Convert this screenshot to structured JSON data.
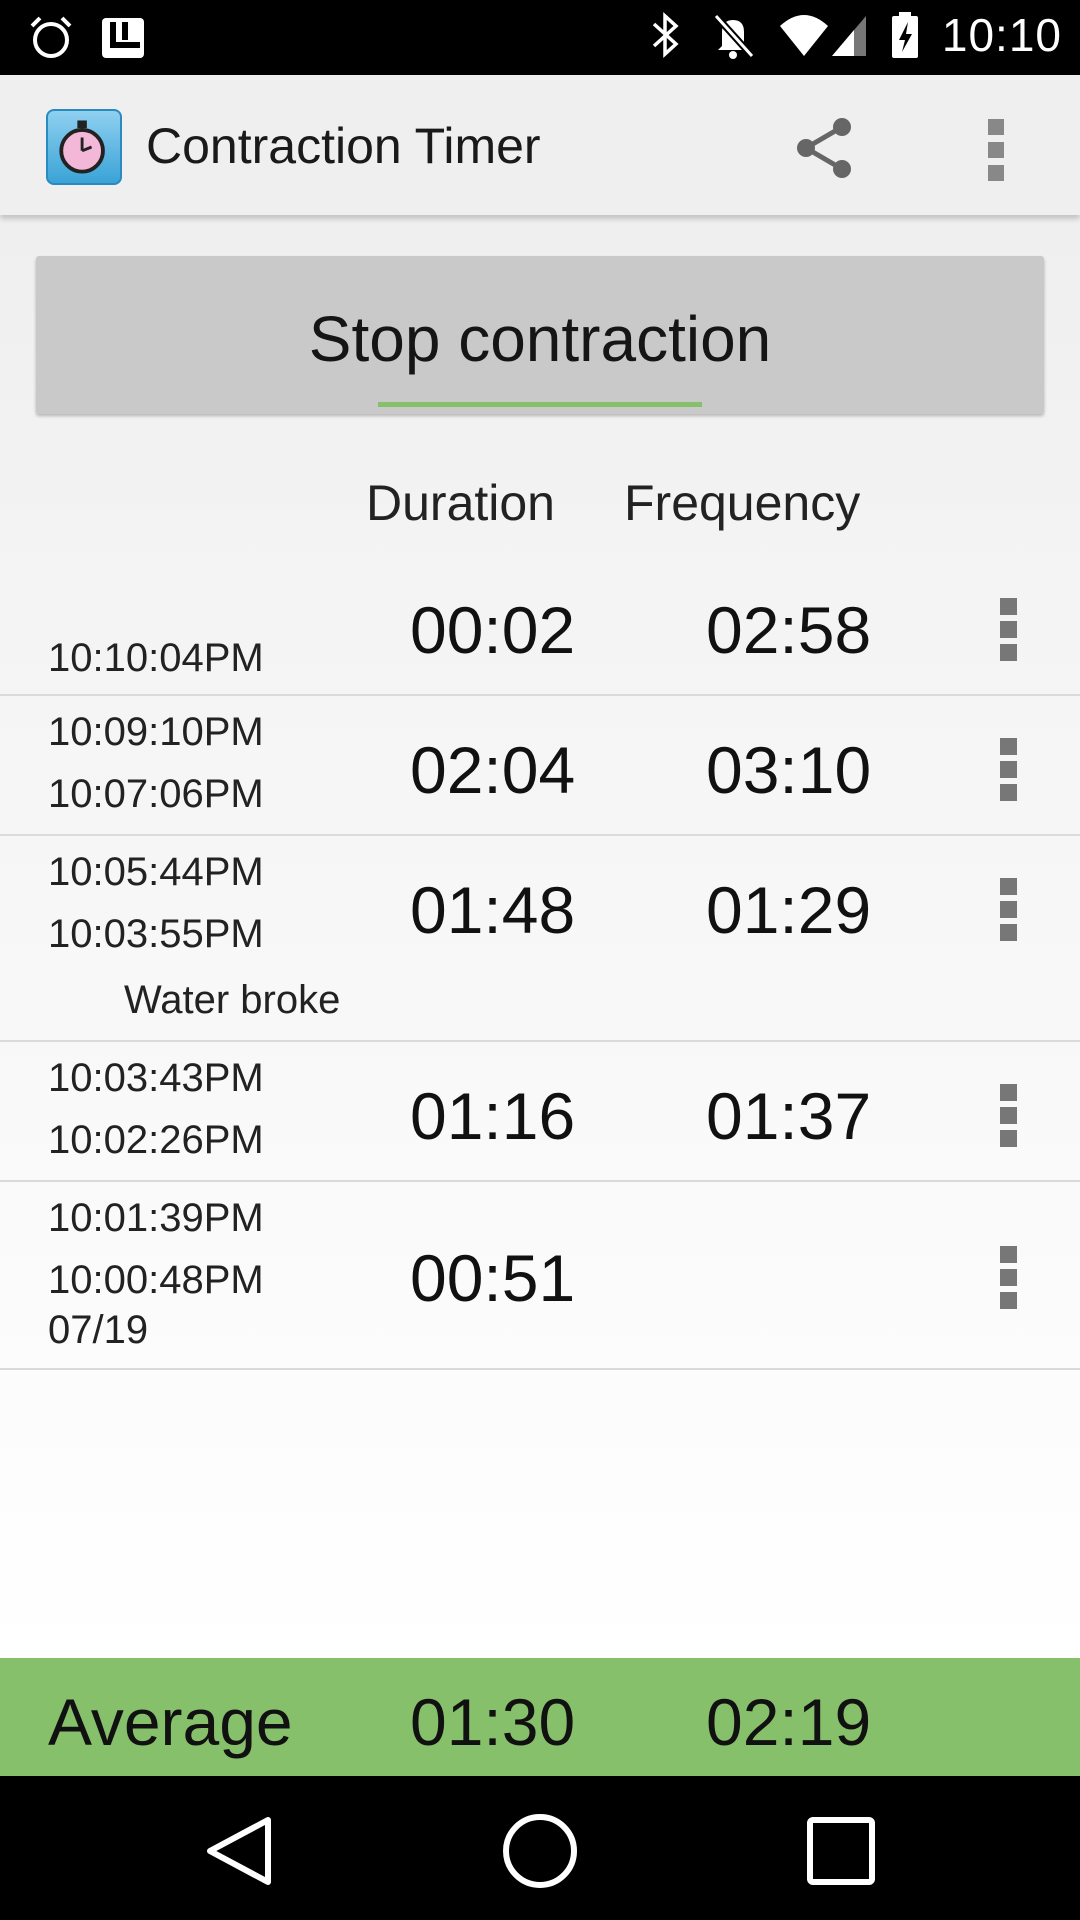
{
  "status_bar": {
    "time": "10:10",
    "icons": [
      "alarm-icon",
      "launcher-icon",
      "bluetooth-icon",
      "muted-bell-icon",
      "wifi-icon",
      "signal-icon",
      "battery-icon"
    ]
  },
  "app_bar": {
    "title": "Contraction Timer",
    "icons": [
      "stopwatch-app-icon",
      "share-icon",
      "overflow-menu-icon"
    ]
  },
  "stop_button": {
    "label": "Stop contraction",
    "accent": "#86c06b"
  },
  "headers": {
    "duration": "Duration",
    "frequency": "Frequency"
  },
  "rows": [
    {
      "end": "",
      "start": "10:10:04PM",
      "duration": "00:02",
      "frequency": "02:58"
    },
    {
      "end": "10:09:10PM",
      "start": "10:07:06PM",
      "duration": "02:04",
      "frequency": "03:10"
    },
    {
      "end": "10:05:44PM",
      "start": "10:03:55PM",
      "duration": "01:48",
      "frequency": "01:29",
      "note": "Water broke"
    },
    {
      "end": "10:03:43PM",
      "start": "10:02:26PM",
      "duration": "01:16",
      "frequency": "01:37"
    },
    {
      "end": "10:01:39PM",
      "start": "10:00:48PM",
      "duration": "00:51",
      "frequency": "",
      "date": "07/19"
    }
  ],
  "average": {
    "label": "Average",
    "duration": "01:30",
    "frequency": "02:19",
    "color": "#86c06b"
  },
  "nav_bar": {
    "icons": [
      "back-icon",
      "home-icon",
      "recents-icon"
    ]
  }
}
